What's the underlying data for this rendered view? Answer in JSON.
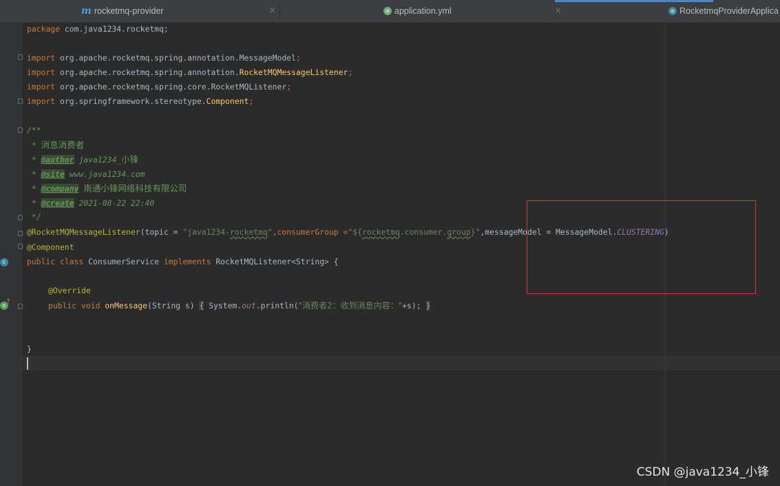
{
  "tabs": [
    {
      "label": "rocketmq-provider",
      "icon": "m-module-icon",
      "active": false
    },
    {
      "label": "application.yml",
      "icon": "spring-config-icon",
      "active": false
    },
    {
      "label": "RocketmqProviderApplica",
      "icon": "spring-class-icon",
      "active": true
    }
  ],
  "tab_close_glyph": "×",
  "code": {
    "package_kw": "package",
    "package_name": " com.java1234.rocketmq;",
    "import_kw": "import",
    "imports": [
      {
        "prefix": " org.apache.rocketmq.spring.annotation.",
        "name": "MessageModel",
        "suffix": ";"
      },
      {
        "prefix": " org.apache.rocketmq.spring.annotation.",
        "name": "RocketMQMessageListener",
        "suffix": ";"
      },
      {
        "prefix": " org.apache.rocketmq.spring.core.",
        "name": "RocketMQListener",
        "suffix": ";"
      },
      {
        "prefix": " org.springframework.stereotype.",
        "name": "Component",
        "suffix": ";"
      }
    ],
    "javadoc_open": "/**",
    "javadoc_star": " * ",
    "javadoc_desc": "消息消费者",
    "javadoc_tags": [
      {
        "tag": "@author",
        "value": " java1234_",
        "value_cn": "小锋"
      },
      {
        "tag": "@site",
        "value": " www.java1234.com",
        "value_cn": ""
      },
      {
        "tag": "@company",
        "value": " ",
        "value_cn": "南通小锋网络科技有限公司"
      },
      {
        "tag": "@create",
        "value": " 2021-08-22 22:40",
        "value_cn": ""
      }
    ],
    "javadoc_close": " */",
    "listener_ann": "@RocketMQMessageListener",
    "listener_args_1": "(topic = ",
    "topic_str_a": "\"java1234-",
    "topic_str_b": "rocketmq",
    "topic_str_c": "\"",
    "listener_args_2": ",consumerGroup =",
    "group_str_a": "\"${",
    "group_str_b": "rocketmq",
    "group_str_c": ".consumer.",
    "group_str_d": "group",
    "group_str_e": "}\"",
    "listener_args_3": ",messageModel = MessageModel.",
    "clustering": "CLUSTERING",
    "listener_args_4": ")",
    "component_ann": "@Component",
    "class_kw": "public class ",
    "class_name": "ConsumerService ",
    "implements_kw": "implements ",
    "class_rest": "RocketMQListener<String> {",
    "override_ann": "@Override",
    "method_kw": "public void ",
    "method_name": "onMessage",
    "method_params": "(String s) ",
    "brace_open": "{",
    "method_body_a": " System.",
    "out_field": "out",
    "method_body_b": ".println(",
    "println_str_a": "\"消费者2：收到消息内容：\"",
    "method_body_c": "+s); ",
    "brace_close": "}",
    "class_close": "}"
  },
  "watermark": "CSDN @java1234_小锋",
  "colors": {
    "background": "#2b2b2b",
    "keyword": "#cc7832",
    "annotation": "#bbb529",
    "string": "#6a8759",
    "highlight_box": "#d33b3b"
  }
}
